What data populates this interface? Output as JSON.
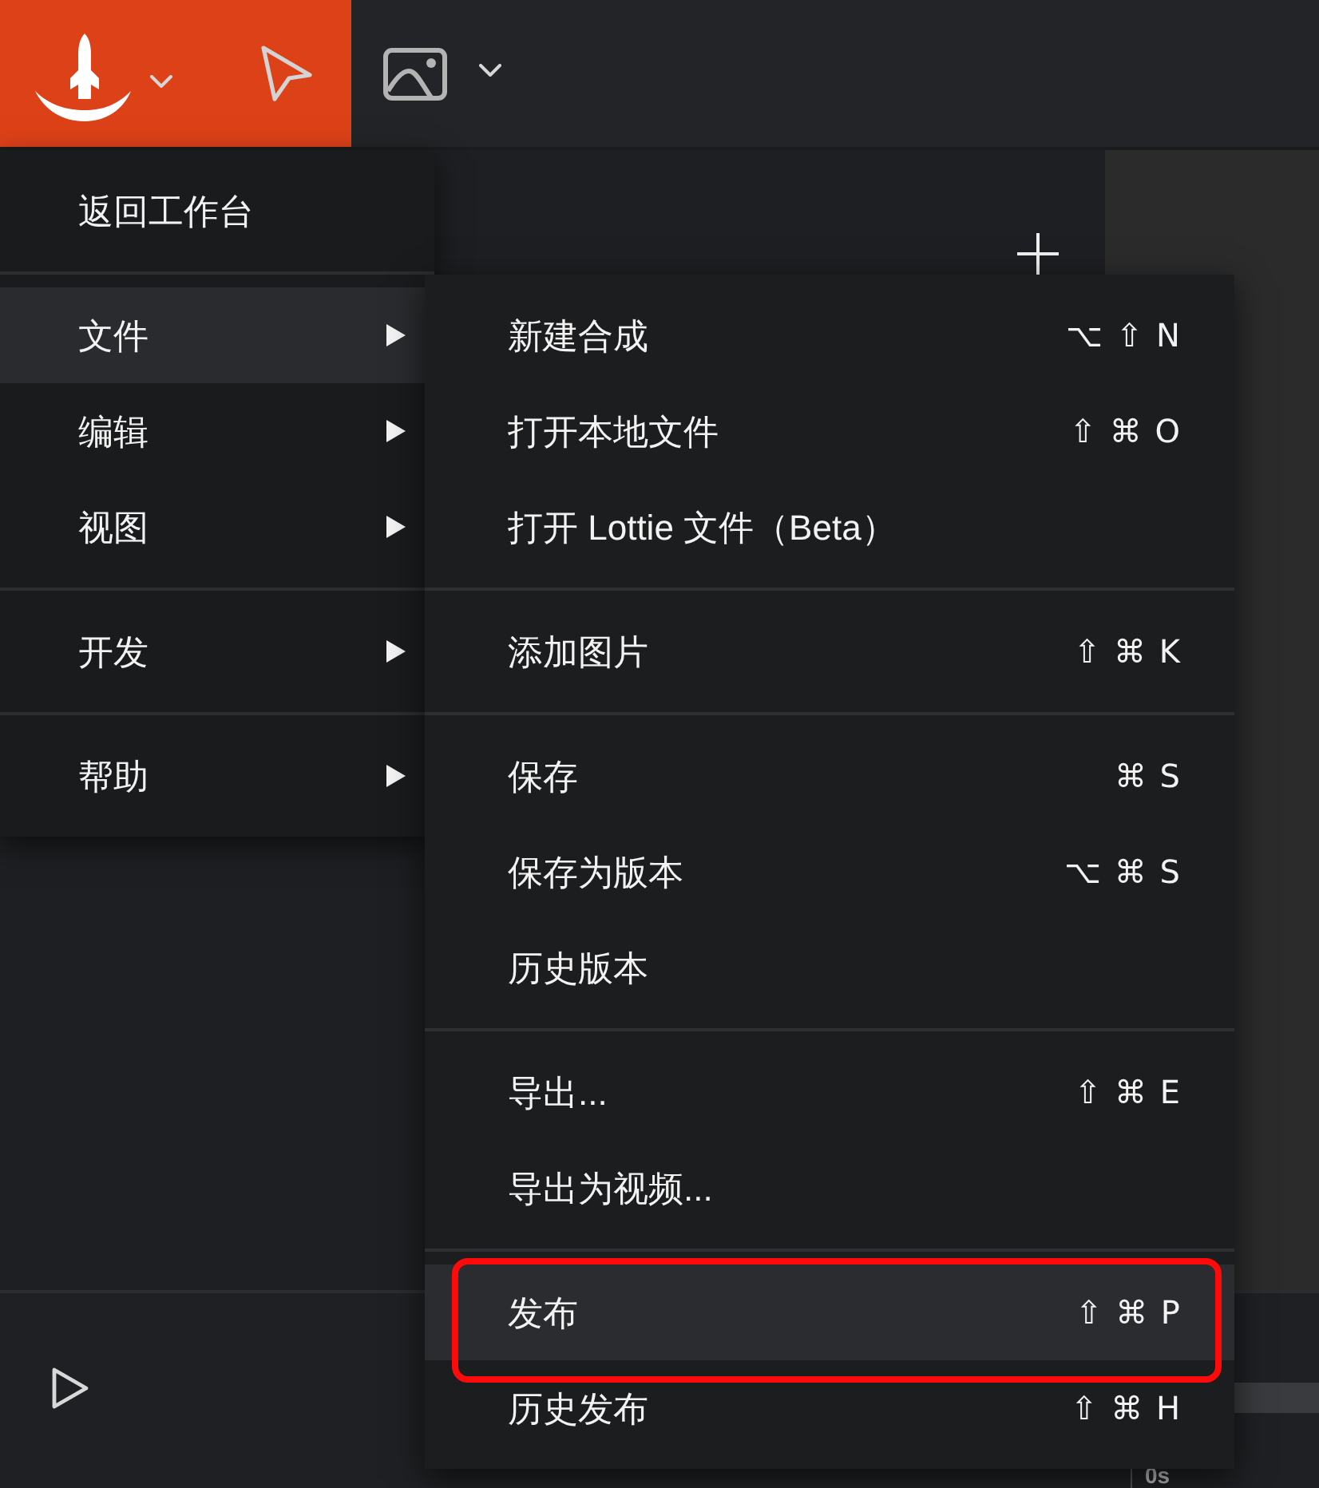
{
  "main_menu": {
    "groups": [
      {
        "items": [
          {
            "label": "返回工作台",
            "selected": false,
            "has_submenu": false
          }
        ]
      },
      {
        "items": [
          {
            "label": "文件",
            "selected": true,
            "has_submenu": true
          },
          {
            "label": "编辑",
            "selected": false,
            "has_submenu": true
          },
          {
            "label": "视图",
            "selected": false,
            "has_submenu": true
          }
        ]
      },
      {
        "items": [
          {
            "label": "开发",
            "selected": false,
            "has_submenu": true
          }
        ]
      },
      {
        "items": [
          {
            "label": "帮助",
            "selected": false,
            "has_submenu": true
          }
        ]
      }
    ]
  },
  "submenu": {
    "groups": [
      {
        "items": [
          {
            "label": "新建合成",
            "shortcut": "⌥ ⇧ N",
            "selected": false,
            "annotated": false
          },
          {
            "label": "打开本地文件",
            "shortcut": "⇧ ⌘ O",
            "selected": false,
            "annotated": false
          },
          {
            "label": "打开 Lottie 文件（Beta）",
            "selected": false,
            "annotated": false
          }
        ]
      },
      {
        "items": [
          {
            "label": "添加图片",
            "shortcut": "⇧ ⌘ K",
            "selected": false,
            "annotated": false
          }
        ]
      },
      {
        "items": [
          {
            "label": "保存",
            "shortcut": "⌘ S",
            "selected": false,
            "annotated": false
          },
          {
            "label": "保存为版本",
            "shortcut": "⌥ ⌘ S",
            "selected": false,
            "annotated": false
          },
          {
            "label": "历史版本",
            "selected": false,
            "annotated": false
          }
        ]
      },
      {
        "items": [
          {
            "label": "导出...",
            "shortcut": "⇧ ⌘ E",
            "selected": false,
            "annotated": false
          },
          {
            "label": "导出为视频...",
            "selected": false,
            "annotated": false
          }
        ]
      },
      {
        "items": [
          {
            "label": "发布",
            "shortcut": "⇧ ⌘ P",
            "selected": true,
            "annotated": true
          },
          {
            "label": "历史发布",
            "shortcut": "⇧ ⌘ H",
            "selected": false,
            "annotated": false
          }
        ]
      }
    ]
  },
  "timeline": {
    "time_label": "0s"
  }
}
